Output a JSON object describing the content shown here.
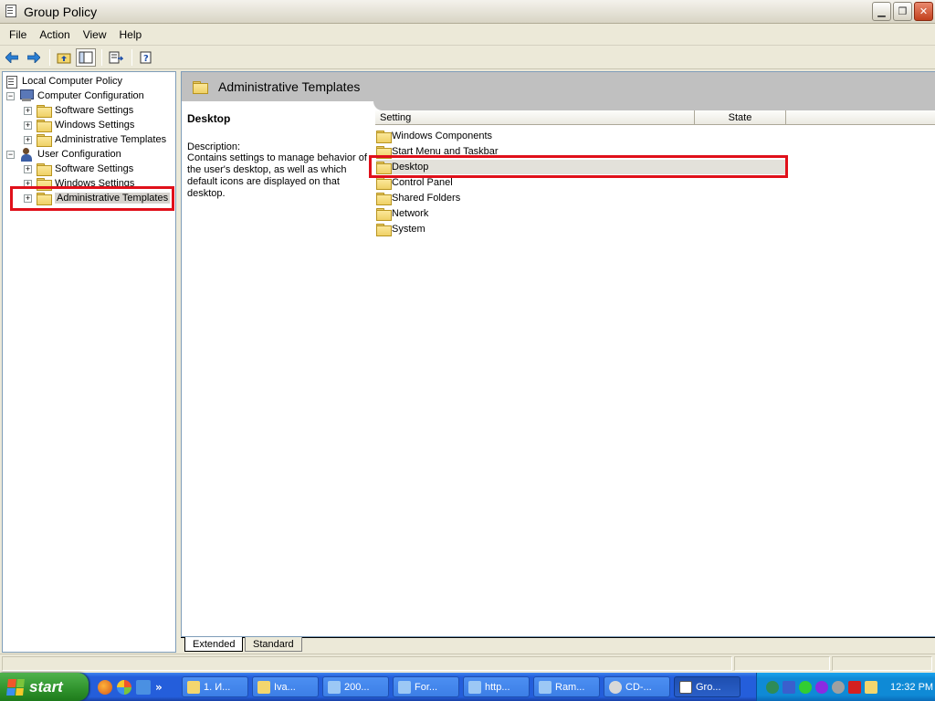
{
  "window": {
    "title": "Group Policy",
    "controls": [
      "minimize",
      "restore",
      "close"
    ]
  },
  "menu": [
    "File",
    "Action",
    "View",
    "Help"
  ],
  "toolbar": {
    "icons": [
      "back-arrow-icon",
      "forward-arrow-icon",
      "up-folder-icon",
      "show-hide-tree-icon",
      "export-list-icon",
      "help-icon"
    ]
  },
  "tree": {
    "root": "Local Computer Policy",
    "computer": {
      "label": "Computer Configuration",
      "children": [
        "Software Settings",
        "Windows Settings",
        "Administrative Templates"
      ]
    },
    "user": {
      "label": "User Configuration",
      "children": [
        "Software Settings",
        "Windows Settings",
        "Administrative Templates"
      ]
    }
  },
  "right": {
    "header_title": "Administrative Templates",
    "desc_title": "Desktop",
    "desc_label": "Description:",
    "desc_text": "Contains settings to manage behavior of the user's desktop, as well as which default icons are displayed on that desktop.",
    "columns": [
      "Setting",
      "State"
    ],
    "items": [
      "Windows Components",
      "Start Menu and Taskbar",
      "Desktop",
      "Control Panel",
      "Shared Folders",
      "Network",
      "System"
    ],
    "selected_item": "Desktop"
  },
  "tabs": [
    "Extended",
    "Standard"
  ],
  "active_tab": "Extended",
  "taskbar": {
    "start_label": "start",
    "quick_launch_more": "»",
    "tasks": [
      "1. И...",
      "Iva...",
      "200...",
      "For...",
      "http...",
      "Ram...",
      "CD-...",
      "Gro..."
    ],
    "active_task": "Gro...",
    "clock": "12:32 PM"
  },
  "colors": {
    "highlight_box": "#e0101a",
    "taskbar_blue": "#245edb",
    "start_green": "#2f922c"
  }
}
